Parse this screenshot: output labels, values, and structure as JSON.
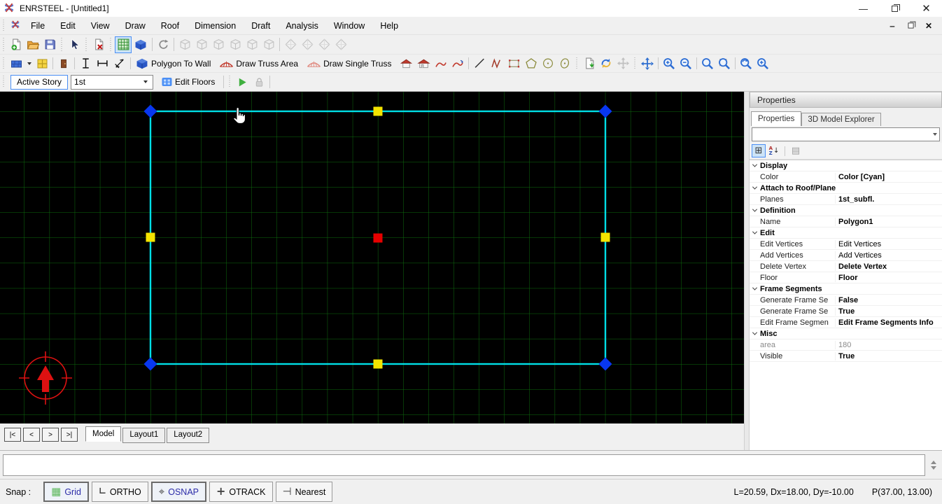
{
  "window": {
    "title": "ENRSTEEL - [Untitled1]"
  },
  "menu": {
    "items": [
      "File",
      "Edit",
      "View",
      "Draw",
      "Roof",
      "Dimension",
      "Draft",
      "Analysis",
      "Window",
      "Help"
    ]
  },
  "toolbar_draw": {
    "polygon_to_wall": "Polygon To Wall",
    "draw_truss_area": "Draw Truss Area",
    "draw_single_truss": "Draw Single Truss"
  },
  "toolbar_story": {
    "active_story_label": "Active Story",
    "story_value": "1st",
    "edit_floors_label": "Edit Floors"
  },
  "properties_panel": {
    "title": "Properties",
    "tabs": [
      {
        "label": "Properties",
        "active": true
      },
      {
        "label": "3D Model Explorer",
        "active": false
      }
    ],
    "selector_value": "",
    "rows": [
      {
        "type": "category",
        "label": "Display"
      },
      {
        "type": "prop",
        "label": "Color",
        "value": "Color [Cyan]",
        "bold": true
      },
      {
        "type": "category",
        "label": "Attach to Roof/Plane"
      },
      {
        "type": "prop",
        "label": "Planes",
        "value": "1st_subfl.",
        "bold": true
      },
      {
        "type": "category",
        "label": "Definition"
      },
      {
        "type": "prop",
        "label": "Name",
        "value": "Polygon1",
        "bold": true
      },
      {
        "type": "category",
        "label": "Edit"
      },
      {
        "type": "prop",
        "label": "Edit Vertices",
        "value": "Edit Vertices",
        "bold": false
      },
      {
        "type": "prop",
        "label": "Add Vertices",
        "value": "Add Vertices",
        "bold": false
      },
      {
        "type": "prop",
        "label": "Delete Vertex",
        "value": "Delete Vertex",
        "bold": true
      },
      {
        "type": "prop",
        "label": "Floor",
        "value": "Floor",
        "bold": true
      },
      {
        "type": "category",
        "label": "Frame Segments"
      },
      {
        "type": "prop",
        "label": "Generate Frame Se",
        "value": "False",
        "bold": true
      },
      {
        "type": "prop",
        "label": "Generate Frame Se",
        "value": "True",
        "bold": true
      },
      {
        "type": "prop",
        "label": "Edit Frame Segmen",
        "value": "Edit Frame Segments Info",
        "bold": true
      },
      {
        "type": "category",
        "label": "Misc"
      },
      {
        "type": "prop",
        "label": "area",
        "value": "180",
        "bold": false,
        "readonly": true
      },
      {
        "type": "prop",
        "label": "Visible",
        "value": "True",
        "bold": true
      }
    ]
  },
  "sheet_tabs": {
    "nav": [
      "|<",
      "<",
      ">",
      ">|"
    ],
    "tabs": [
      {
        "label": "Model",
        "active": true
      },
      {
        "label": "Layout1",
        "active": false
      },
      {
        "label": "Layout2",
        "active": false
      }
    ]
  },
  "command_line": {
    "value": ""
  },
  "status_bar": {
    "snap_label": "Snap :",
    "toggles": [
      {
        "label": "Grid",
        "icon": "grid",
        "active": true
      },
      {
        "label": "ORTHO",
        "icon": "ortho",
        "active": false
      },
      {
        "label": "OSNAP",
        "icon": "osnap",
        "active": true
      },
      {
        "label": "OTRACK",
        "icon": "otrack",
        "active": false
      },
      {
        "label": "Nearest",
        "icon": "nearest",
        "active": false
      }
    ],
    "readout": "L=20.59, Dx=18.00, Dy=-10.00",
    "position": "P(37.00, 13.00)"
  },
  "canvas": {
    "selected_object": "Polygon1",
    "polygon_width_units": 18,
    "polygon_height_units": 10,
    "area_units": 180
  },
  "theme": {
    "colors": {
      "canvas-bg": "#000000",
      "grid-green": "#0d6e0d",
      "cyan": "#00dfe6",
      "handle-blue": "#0837f0",
      "handle-yellow": "#f4e400",
      "handle-red": "#e60000",
      "origin-red": "#dd1111",
      "accent": "#4b8ff5",
      "status-blue": "#2b2ba8"
    }
  }
}
